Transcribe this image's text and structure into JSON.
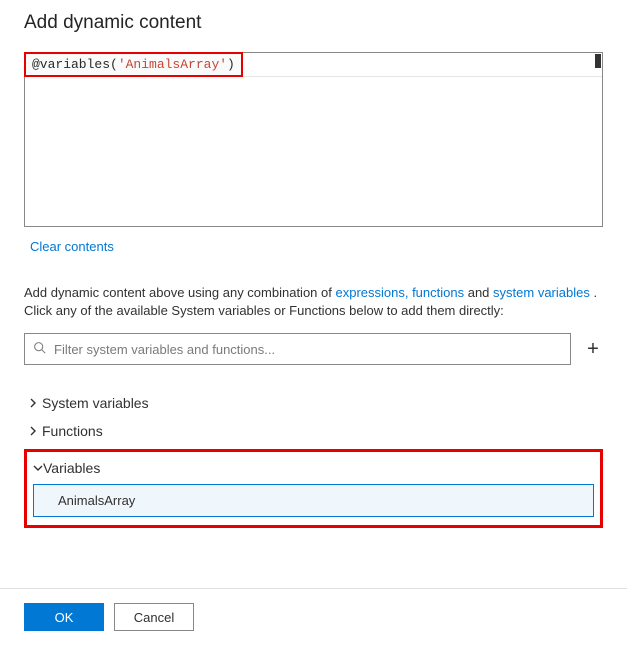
{
  "title": "Add dynamic content",
  "expression": {
    "prefix": "@variables(",
    "arg_quoted": "'AnimalsArray'",
    "suffix": ")"
  },
  "clear_label": "Clear contents",
  "help": {
    "pre": "Add dynamic content above using any combination of ",
    "link1": "expressions, functions",
    "mid": " and ",
    "link2": "system variables",
    "post": " . Click any of the available System variables or Functions below to add them directly:"
  },
  "filter": {
    "placeholder": "Filter system variables and functions..."
  },
  "tree": {
    "system_variables": "System variables",
    "functions": "Functions",
    "variables": "Variables",
    "variable_items": [
      "AnimalsArray"
    ]
  },
  "buttons": {
    "ok": "OK",
    "cancel": "Cancel"
  }
}
